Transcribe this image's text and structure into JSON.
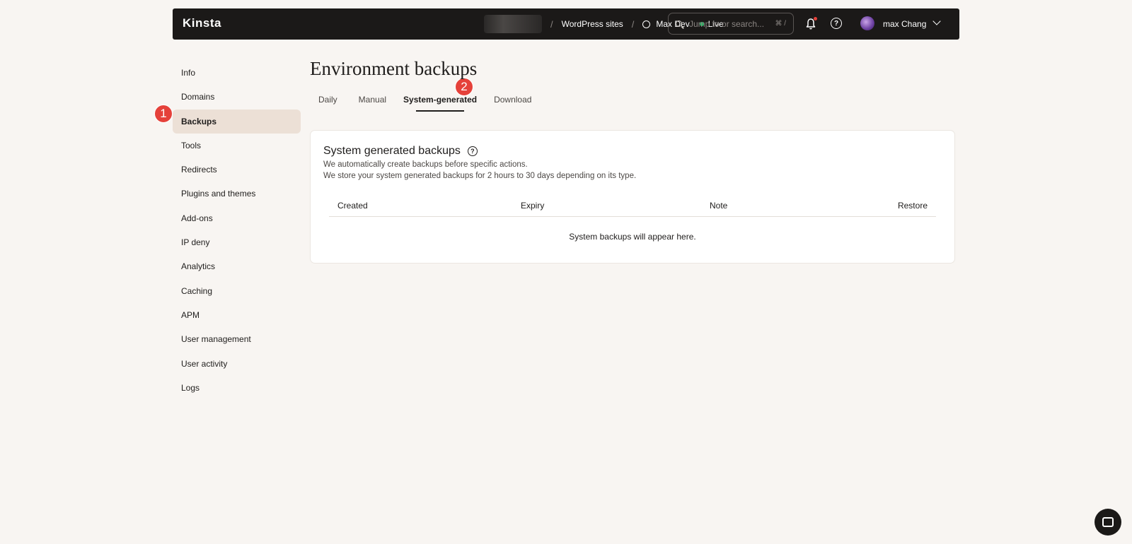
{
  "topbar": {
    "logo": "Kinsta",
    "crumbs": [
      "WordPress sites",
      "Max Dev",
      "Live"
    ],
    "separator": "/",
    "search_placeholder": "Jump to or search...",
    "search_shortcut": "⌘ /",
    "help_glyph": "?",
    "user_name": "max Chang",
    "live_color": "#28b463"
  },
  "sidebar": {
    "items": [
      {
        "label": "Info"
      },
      {
        "label": "Domains"
      },
      {
        "label": "Backups"
      },
      {
        "label": "Tools"
      },
      {
        "label": "Redirects"
      },
      {
        "label": "Plugins and themes"
      },
      {
        "label": "Add-ons"
      },
      {
        "label": "IP deny"
      },
      {
        "label": "Analytics"
      },
      {
        "label": "Caching"
      },
      {
        "label": "APM"
      },
      {
        "label": "User management"
      },
      {
        "label": "User activity"
      },
      {
        "label": "Logs"
      }
    ],
    "active_index": 2
  },
  "markers": [
    "1",
    "2"
  ],
  "main": {
    "title": "Environment backups",
    "tabs": [
      "Daily",
      "Manual",
      "System-generated",
      "Download"
    ],
    "active_tab": 2,
    "card": {
      "title": "System generated backups",
      "help_glyph": "?",
      "description_1": "We automatically create backups before specific actions.",
      "description_2": "We store your system generated backups for 2 hours to 30 days depending on its type.",
      "columns": [
        "Created",
        "Expiry",
        "Note",
        "Restore"
      ],
      "empty_text": "System backups will appear here."
    }
  },
  "colors": {
    "background": "#f8f5f2",
    "topbar": "#1b1918",
    "active_nav": "#ece0d6",
    "marker": "#e5413a",
    "notification_dot": "#e5413a"
  }
}
